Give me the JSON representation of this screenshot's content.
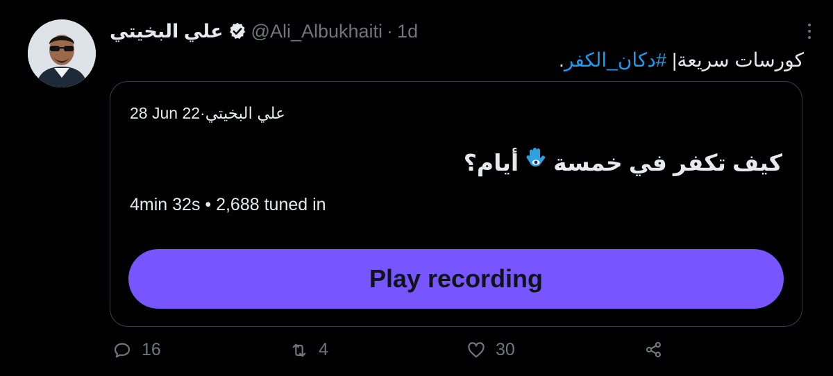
{
  "tweet": {
    "author_name": "علي البخيتي",
    "handle": "@Ali_Albukhaiti",
    "separator": "·",
    "time": "1d",
    "text_prefix": "كورسات سريعة|",
    "hashtag": "#دكان_الكفر",
    "text_suffix": "."
  },
  "space_card": {
    "host": "علي البخيتي",
    "separator": "·",
    "date": "28 Jun 22",
    "title_part1": "كيف تكفر في خمسة",
    "title_part2": "أيام؟",
    "stats": "4min 32s • 2,688 tuned in",
    "play_label": "Play recording",
    "accent_color": "#7856ff"
  },
  "actions": {
    "replies": "16",
    "retweets": "4",
    "likes": "30"
  },
  "icons": [
    "verified-badge-icon",
    "more-icon",
    "hamsa-icon",
    "reply-icon",
    "retweet-icon",
    "like-icon",
    "share-icon"
  ]
}
